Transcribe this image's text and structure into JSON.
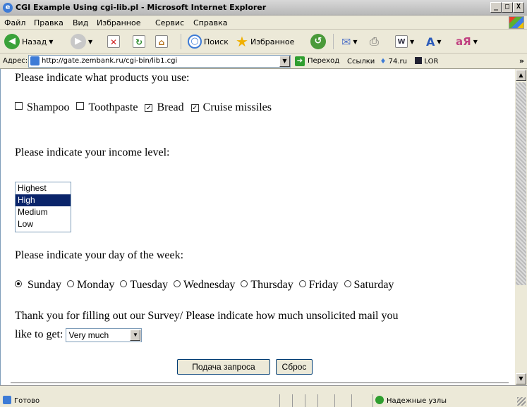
{
  "window": {
    "title": "CGI Example Using cgi-lib.pl - Microsoft Internet Explorer",
    "min": "_",
    "max": "□",
    "close": "X"
  },
  "menu": [
    "Файл",
    "Правка",
    "Вид",
    "Избранное",
    "Сервис",
    "Справка"
  ],
  "toolbar": {
    "back": "Назад",
    "search": "Поиск",
    "favorites": "Избранное"
  },
  "address": {
    "label": "Адрес:",
    "url": "http://gate.zembank.ru/cgi-bin/lib1.cgi",
    "go": "Переход",
    "links": "Ссылки",
    "link1": "74.ru",
    "link2": "LOR"
  },
  "form": {
    "products_q": "Please indicate what products you use:",
    "products": [
      {
        "label": "Shampoo",
        "checked": false
      },
      {
        "label": "Toothpaste",
        "checked": false
      },
      {
        "label": "Bread",
        "checked": true
      },
      {
        "label": "Cruise missiles",
        "checked": true
      }
    ],
    "income_q": "Please indicate your income level:",
    "income": [
      "Highest",
      "High",
      "Medium",
      "Low"
    ],
    "income_selected": "High",
    "day_q": "Please indicate your day of the week:",
    "days": [
      "Sunday",
      "Monday",
      "Tuesday",
      "Wednesday",
      "Thursday",
      "Friday",
      "Saturday"
    ],
    "day_selected": "Sunday",
    "mail_q1": "Thank you for filling out our Survey/ Please indicate how much unsolicited mail you",
    "mail_q2": "like to get:",
    "mail_value": "Very much",
    "submit": "Подача запроса",
    "reset": "Сброс"
  },
  "status": {
    "left": "Готово",
    "right": "Надежные узлы"
  }
}
